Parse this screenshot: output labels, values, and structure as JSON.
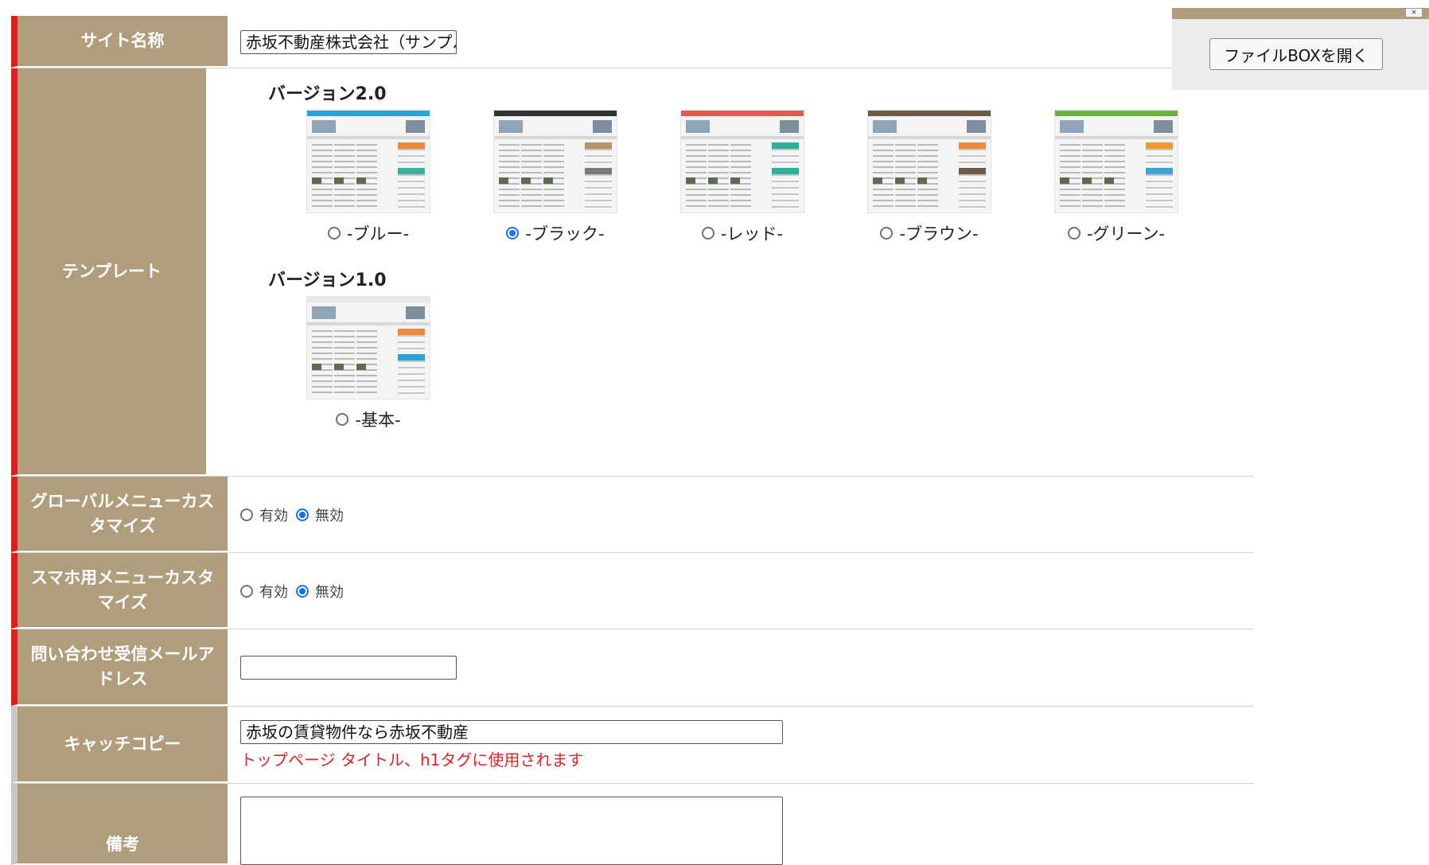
{
  "rows": {
    "site_name": {
      "label": "サイト名称",
      "value": "赤坂不動産株式会社（サンプル）"
    },
    "template": {
      "label": "テンプレート",
      "v2_title": "バージョン2.0",
      "v2_options": [
        {
          "label": "-ブルー-",
          "accent": "#2aa3d6",
          "side_a": "#f08a3a",
          "side_b": "#39b39b",
          "selected": false
        },
        {
          "label": "-ブラック-",
          "accent": "#333333",
          "side_a": "#b39660",
          "side_b": "#7a7a7a",
          "selected": true
        },
        {
          "label": "-レッド-",
          "accent": "#e25a50",
          "side_a": "#2bb39a",
          "side_b": "#2bb39a",
          "selected": false
        },
        {
          "label": "-ブラウン-",
          "accent": "#6d5b4a",
          "side_a": "#f08a3a",
          "side_b": "#6d5b4a",
          "selected": false
        },
        {
          "label": "-グリーン-",
          "accent": "#6bb03c",
          "side_a": "#f09a2a",
          "side_b": "#3aa6d8",
          "selected": false
        }
      ],
      "v1_title": "バージョン1.0",
      "v1_option": {
        "label": "-基本-",
        "accent": "#e8e8e8",
        "side_a": "#f08a3a",
        "side_b": "#2aa3d6",
        "selected": false
      }
    },
    "global_menu": {
      "label": "グローバルメニューカスタマイズ",
      "options": [
        "有効",
        "無効"
      ],
      "selected": "無効"
    },
    "smartphone_menu": {
      "label": "スマホ用メニューカスタマイズ",
      "options": [
        "有効",
        "無効"
      ],
      "selected": "無効"
    },
    "inquiry_email": {
      "label": "問い合わせ受信メールアドレス",
      "value": ""
    },
    "catch_copy": {
      "label": "キャッチコピー",
      "value": "赤坂の賃貸物件なら赤坂不動産",
      "hint": "トップページ タイトル、h1タグに使用されます"
    },
    "note": {
      "label": "備考",
      "value": ""
    }
  },
  "filebox": {
    "button": "ファイルBOXを開く",
    "close_mark": "×"
  },
  "colors": {
    "label_bg": "#b09d7b",
    "required_bar": "#e21b1b",
    "optional_bar": "#c7c7c7",
    "hint": "#e32222",
    "radio_on": "#1a73e8"
  }
}
